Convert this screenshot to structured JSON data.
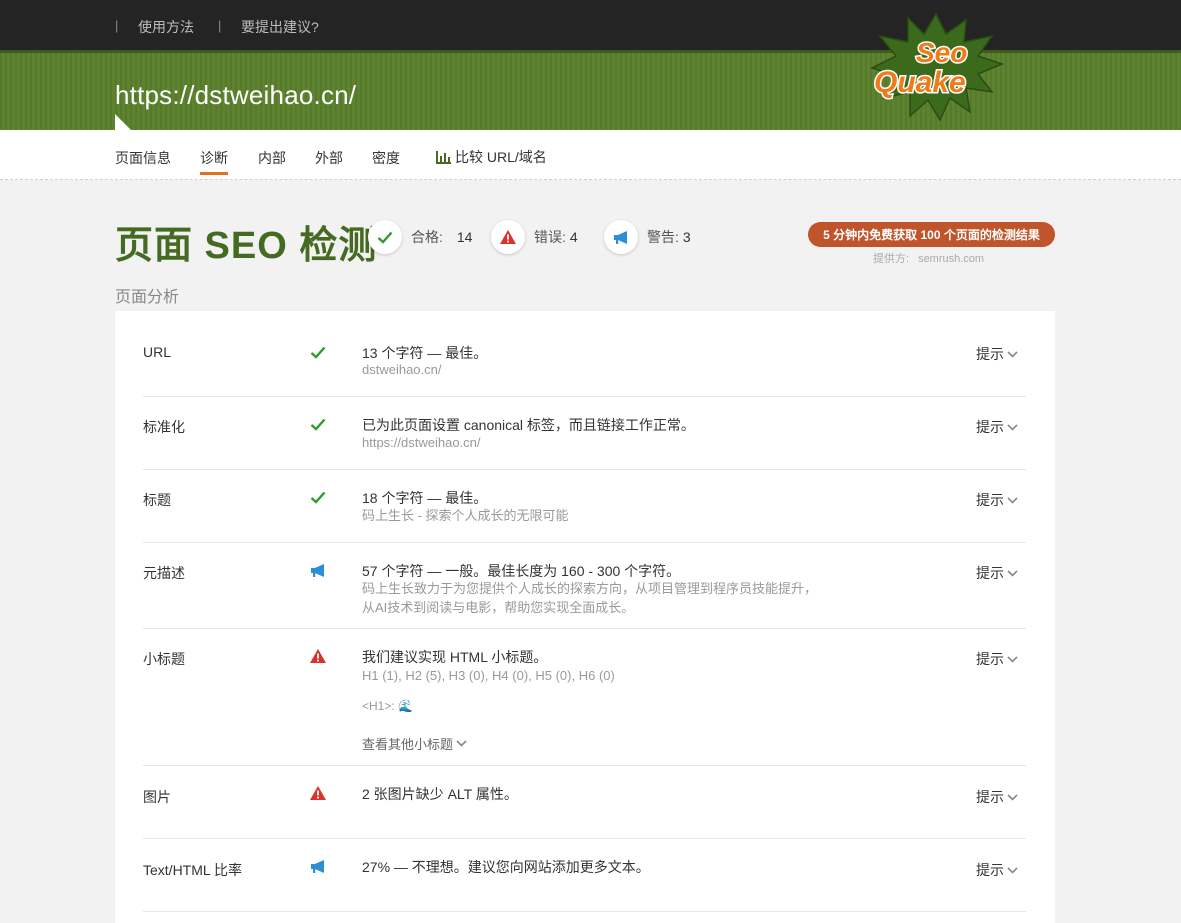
{
  "topnav": {
    "sep": "|",
    "usage": "使用方法",
    "suggest": "要提出建议?"
  },
  "banner": {
    "url": "https://dstweihao.cn/"
  },
  "logo": {
    "word1": "Seo",
    "word2": "Quake"
  },
  "tabs": [
    {
      "label": "页面信息"
    },
    {
      "label": "诊断"
    },
    {
      "label": "内部"
    },
    {
      "label": "外部"
    },
    {
      "label": "密度"
    },
    {
      "label": "比较 URL/域名",
      "icon": "bar-chart-icon"
    }
  ],
  "active_tab": "诊断",
  "heading": "页面 SEO 检测",
  "stats": {
    "pass_label": "合格:",
    "pass_value": "14",
    "error_label": "错误:",
    "error_value": "4",
    "warn_label": "警告:",
    "warn_value": "3"
  },
  "promo": {
    "label": "5 分钟内免费获取 100 个页面的检测结果",
    "provider_label": "提供方:",
    "provider_name": "semrush.com"
  },
  "section_title": "页面分析",
  "colors": {
    "brand_green": "#456a22",
    "banner_green": "#5a7f2c",
    "accent_orange": "#e2711d",
    "ok": "#2e9b2e",
    "error": "#d9342b",
    "warn": "#2b8fd6",
    "promo": "#c0542a"
  },
  "hint_label": "提示",
  "rows": [
    {
      "label": "URL",
      "status": "ok",
      "main": "13 个字符 — 最佳。",
      "sub": "dstweihao.cn/"
    },
    {
      "label": "标准化",
      "status": "ok",
      "main": "已为此页面设置 canonical 标签，而且链接工作正常。",
      "sub": "https://dstweihao.cn/"
    },
    {
      "label": "标题",
      "status": "ok",
      "main": "18 个字符 — 最佳。",
      "sub": "码上生长 - 探索个人成长的无限可能"
    },
    {
      "label": "元描述",
      "status": "warn",
      "main": "57 个字符 — 一般。最佳长度为 160 - 300 个字符。",
      "sub": "码上生长致力于为您提供个人成长的探索方向，从项目管理到程序员技能提升，",
      "sub2": "从AI技术到阅读与电影，帮助您实现全面成长。"
    },
    {
      "label": "小标题",
      "status": "error",
      "main": "我们建议实现 HTML 小标题。",
      "sub": "H1 (1), H2 (5), H3 (0), H4 (0), H5 (0), H6 (0)",
      "h1_label": "<H1>:",
      "h1_icon": "🌊",
      "more": "查看其他小标题"
    },
    {
      "label": "图片",
      "status": "error",
      "main": "2 张图片缺少 ALT 属性。"
    },
    {
      "label": "Text/HTML 比率",
      "status": "warn",
      "main": "27% — 不理想。建议您向网站添加更多文本。"
    }
  ]
}
